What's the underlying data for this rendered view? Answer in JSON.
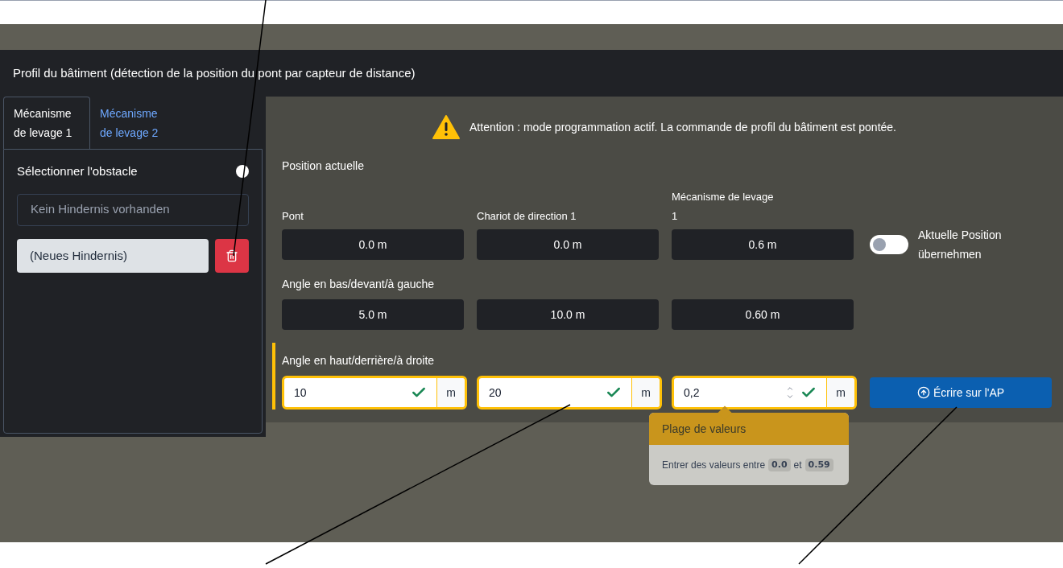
{
  "header": {
    "title": "Profil du bâtiment (détection de la position du pont par capteur de distance)"
  },
  "tabs": [
    {
      "label": "Mécanisme de levage 1",
      "selected": true
    },
    {
      "label": "Mécanisme de levage 2",
      "selected": false
    }
  ],
  "obstacle": {
    "label": "Sélectionner l'obstacle",
    "toggle_on": true,
    "list_placeholder": "Kein Hindernis vorhanden",
    "name_value": "(Neues Hindernis)"
  },
  "alert": {
    "text": "Attention : mode programmation actif. La commande de profil du bâtiment est pontée."
  },
  "position": {
    "title": "Position actuelle",
    "fields": [
      {
        "label": "Pont",
        "value": "0.0 m"
      },
      {
        "label": "Chariot de direction 1",
        "value": "0.0 m"
      },
      {
        "label": "Mécanisme de levage 1",
        "value": "0.6 m"
      }
    ],
    "toggle": {
      "label": "Aktuelle Position übernehmen",
      "on": false
    }
  },
  "bottom_left": {
    "title": "Angle en bas/devant/à gauche",
    "values": [
      "5.0 m",
      "10.0 m",
      "0.60 m"
    ]
  },
  "top_right": {
    "title": "Angle en haut/derrière/à droite",
    "inputs": [
      {
        "value": "10",
        "unit": "m",
        "valid": true,
        "focused": false
      },
      {
        "value": "20",
        "unit": "m",
        "valid": true,
        "focused": false
      },
      {
        "value": "0,2",
        "unit": "m",
        "valid": true,
        "focused": true
      }
    ],
    "write_button": "Écrire sur l'AP"
  },
  "popover": {
    "title": "Plage de valeurs",
    "text": "Entrer des valeurs entre",
    "min": "0.0",
    "joiner": "et",
    "max": "0.59"
  }
}
